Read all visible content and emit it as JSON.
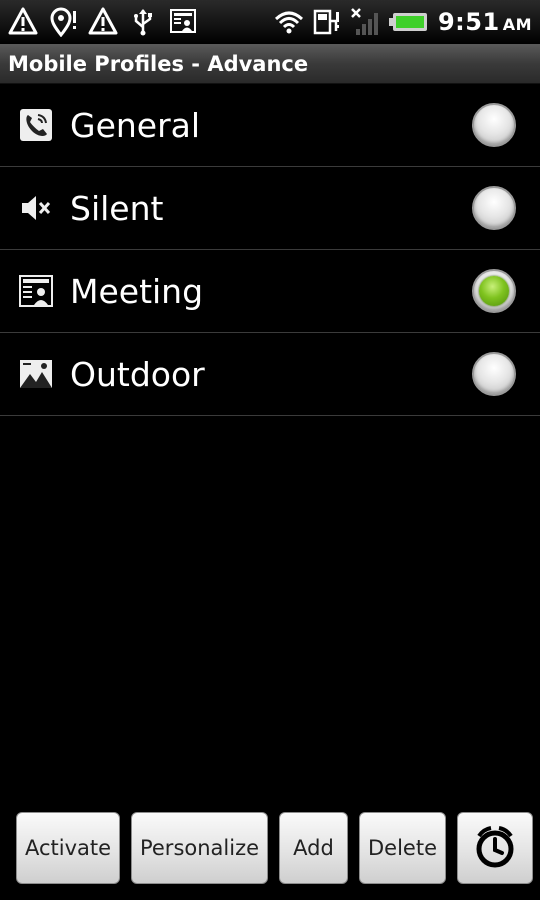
{
  "status_bar": {
    "left_icons": [
      "warning-icon",
      "location-pin-icon",
      "warning-icon",
      "usb-icon",
      "profile-notification-icon"
    ],
    "right_icons": [
      "wifi-icon",
      "data-sync-icon",
      "no-signal-icon",
      "battery-icon"
    ],
    "time": "9:51",
    "ampm": "AM"
  },
  "title": "Mobile Profiles - Advance",
  "profiles": [
    {
      "label": "General",
      "icon": "phone-ring-icon",
      "selected": false
    },
    {
      "label": "Silent",
      "icon": "speaker-muted-icon",
      "selected": false
    },
    {
      "label": "Meeting",
      "icon": "meeting-icon",
      "selected": true
    },
    {
      "label": "Outdoor",
      "icon": "outdoor-icon",
      "selected": false
    }
  ],
  "buttons": {
    "activate": "Activate",
    "personalize": "Personalize",
    "add": "Add",
    "delete": "Delete",
    "timer_icon": "timer-icon"
  },
  "colors": {
    "background": "#000000",
    "selected_radio": "#7fc31f",
    "divider": "#3b3b3b"
  }
}
